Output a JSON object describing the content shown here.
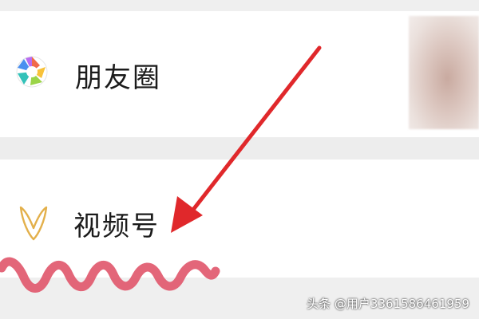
{
  "menu": {
    "items": [
      {
        "label": "朋友圈",
        "icon": "moments-aperture-icon"
      },
      {
        "label": "视频号",
        "icon": "channels-butterfly-icon"
      }
    ]
  },
  "annotations": {
    "arrow_color": "#e0282b",
    "squiggle_color": "#e0556a"
  },
  "watermark": {
    "text": "头条 @用户3361586461959"
  }
}
